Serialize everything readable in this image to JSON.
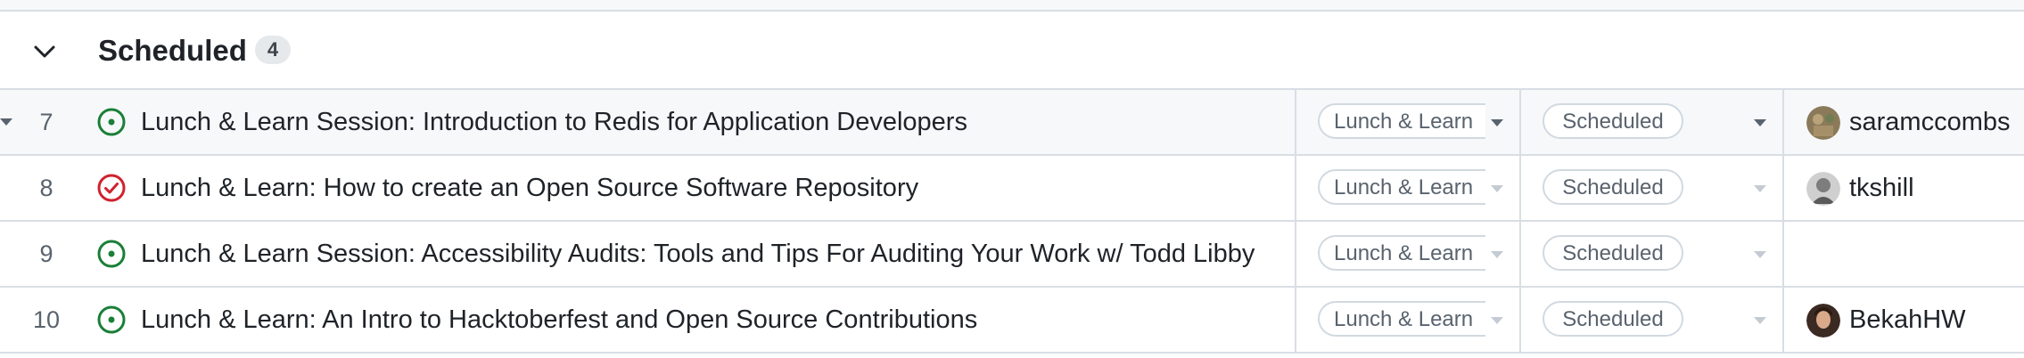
{
  "group": {
    "title": "Scheduled",
    "count": "4"
  },
  "rows": [
    {
      "number": "7",
      "status": "open",
      "title": "Lunch & Learn Session: Introduction to Redis for Application Developers",
      "type": "Lunch & Learn",
      "status_label": "Scheduled",
      "assignee": "saramccombs",
      "avatar_icon": "avatar-saramccombs"
    },
    {
      "number": "8",
      "status": "closed",
      "title": "Lunch & Learn: How to create an Open Source Software Repository",
      "type": "Lunch & Learn",
      "status_label": "Scheduled",
      "assignee": "tkshill",
      "avatar_icon": "avatar-tkshill"
    },
    {
      "number": "9",
      "status": "open",
      "title": "Lunch & Learn Session: Accessibility Audits: Tools and Tips For Auditing Your Work w/ Todd Libby",
      "type": "Lunch & Learn",
      "status_label": "Scheduled",
      "assignee": "",
      "avatar_icon": ""
    },
    {
      "number": "10",
      "status": "open",
      "title": "Lunch & Learn: An Intro to Hacktoberfest and Open Source Contributions",
      "type": "Lunch & Learn",
      "status_label": "Scheduled",
      "assignee": "BekahHW",
      "avatar_icon": "avatar-BekahHW"
    }
  ],
  "colors": {
    "open_icon": "#1a7f37",
    "closed_icon": "#cf222e",
    "border": "#d8dee4",
    "muted_text": "#59636e"
  }
}
